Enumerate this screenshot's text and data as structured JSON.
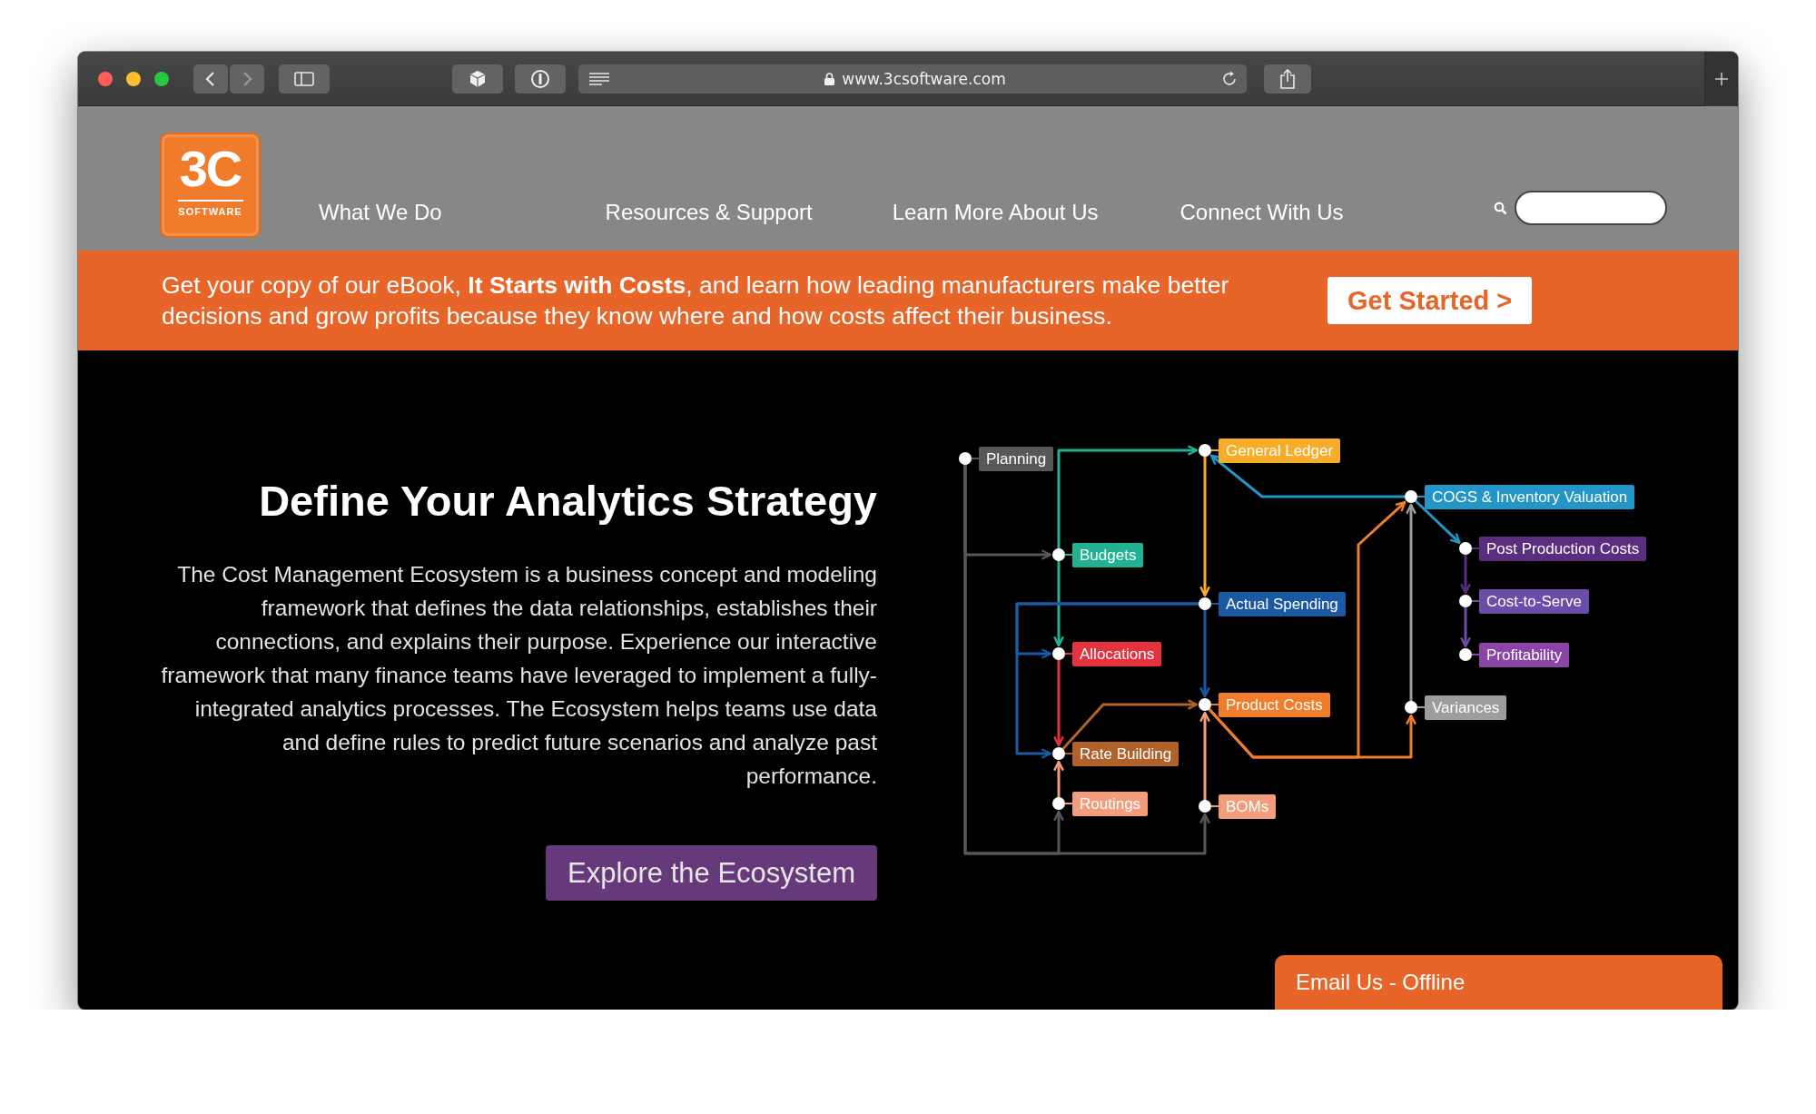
{
  "browser": {
    "url": "www.3csoftware.com"
  },
  "header": {
    "logo": {
      "mark": "3C",
      "sub": "SOFTWARE"
    },
    "nav": [
      {
        "label": "What We Do"
      },
      {
        "label": "Resources & Support"
      },
      {
        "label": "Learn More About Us"
      },
      {
        "label": "Connect With Us"
      }
    ]
  },
  "promo": {
    "text": "Get your copy of our eBook, **It Starts with Costs**, and learn how leading manufacturers make better decisions and grow profits because they know where and how costs affect their business.",
    "button": "Get Started >"
  },
  "hero": {
    "title": "Define Your Analytics Strategy",
    "body": "The Cost Management Ecosystem is a business concept and modeling framework that defines the data relationships, establishes their connections, and explains their purpose. Experience our interactive framework that many finance teams have leveraged to implement a fully-integrated analytics processes. The Ecosystem helps teams use data and define rules to predict future scenarios and analyze past performance.",
    "button": "Explore the Ecosystem"
  },
  "diagram": {
    "nodes": [
      {
        "label": "Planning",
        "color": "#58585a"
      },
      {
        "label": "General Ledger",
        "color": "#f7ad2a"
      },
      {
        "label": "COGS & Inventory Valuation",
        "color": "#2395c6"
      },
      {
        "label": "Budgets",
        "color": "#22b293"
      },
      {
        "label": "Post Production Costs",
        "color": "#5a2e7e"
      },
      {
        "label": "Actual Spending",
        "color": "#1b5aa3"
      },
      {
        "label": "Cost-to-Serve",
        "color": "#6b4ca6"
      },
      {
        "label": "Allocations",
        "color": "#e5323f"
      },
      {
        "label": "Profitability",
        "color": "#8a45a6"
      },
      {
        "label": "Product Costs",
        "color": "#ef7d2c"
      },
      {
        "label": "Variances",
        "color": "#9d9d9f"
      },
      {
        "label": "Rate Building",
        "color": "#b1622b"
      },
      {
        "label": "Routings",
        "color": "#f29d7c"
      },
      {
        "label": "BOMs",
        "color": "#f29d7c"
      }
    ]
  },
  "chat_tab": {
    "label": "Email Us - Offline"
  }
}
